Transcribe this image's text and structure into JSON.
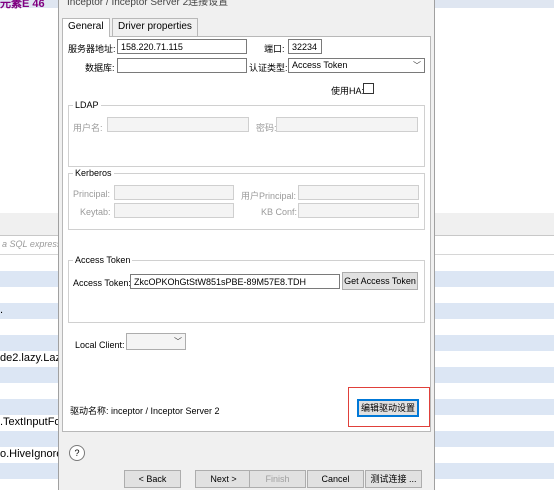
{
  "background": {
    "top_text": "元素E 46",
    "filter_placeholder": "a SQL express",
    "rows": [
      {
        "text": "",
        "alt": true
      },
      {
        "text": "",
        "alt": false
      },
      {
        "text": ".",
        "alt": true
      },
      {
        "text": "",
        "alt": false
      },
      {
        "text": "",
        "alt": true
      },
      {
        "text": "de2.lazy.Lazy",
        "alt": false
      },
      {
        "text": "",
        "alt": true
      },
      {
        "text": "",
        "alt": false
      },
      {
        "text": "",
        "alt": true
      },
      {
        "text": ".TextInputFo",
        "alt": false
      },
      {
        "text": "",
        "alt": true
      },
      {
        "text": "o.HiveIgnore",
        "alt": false
      },
      {
        "text": "",
        "alt": true
      }
    ]
  },
  "dialog": {
    "title": "Inceptor / Inceptor Server 2连接设置",
    "tabs": [
      "General",
      "Driver properties"
    ],
    "general": {
      "host_label": "服务器地址:",
      "host_value": "158.220.71.115",
      "port_label": "端口:",
      "port_value": "32234",
      "db_label": "数据库:",
      "db_value": "",
      "auth_label": "认证类型:",
      "auth_value": "Access Token",
      "ha_label": "使用HA:",
      "ha_checked": false
    },
    "ldap": {
      "legend": "LDAP",
      "user_label": "用户名:",
      "pass_label": "密码:"
    },
    "kerberos": {
      "legend": "Kerberos",
      "principal_label": "Principal:",
      "user_principal_label": "用户Principal:",
      "keytab_label": "Keytab:",
      "kb_conf_label": "KB Conf:"
    },
    "access_token": {
      "legend": "Access Token",
      "label": "Access Token:",
      "value": "ZkcOPKOhGtStW851sPBE-89M57E8.TDH",
      "button": "Get Access Token"
    },
    "local_client": {
      "label": "Local Client:",
      "value": ""
    },
    "driver": {
      "label": "驱动名称: inceptor / Inceptor Server 2",
      "edit_button": "编辑驱动设置"
    },
    "footer": {
      "help": "?",
      "back": "< Back",
      "next": "Next >",
      "finish": "Finish",
      "cancel": "Cancel",
      "test": "测试连接 ..."
    }
  }
}
